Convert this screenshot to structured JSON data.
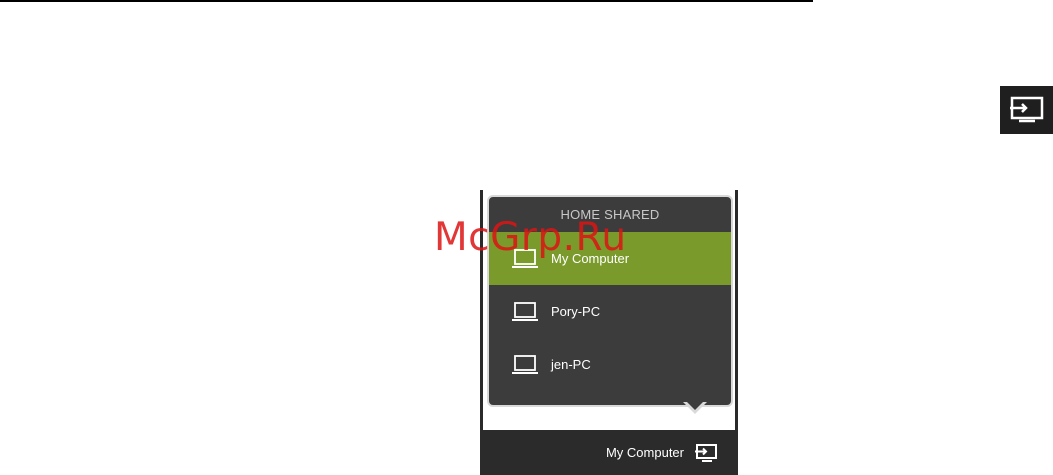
{
  "watermark": "McGrp.Ru",
  "side_icon": "input-source-icon",
  "popup": {
    "header": "HOME SHARED",
    "items": [
      {
        "label": "My Computer",
        "icon": "laptop-icon",
        "selected": true
      },
      {
        "label": "Pory-PC",
        "icon": "laptop-icon",
        "selected": false
      },
      {
        "label": "jen-PC",
        "icon": "laptop-icon",
        "selected": false
      }
    ]
  },
  "footer": {
    "current_source": "My Computer",
    "icon": "input-source-icon"
  },
  "colors": {
    "selected_item": "#7a9b2c",
    "popup_background": "#3c3c3c",
    "footer_background": "#2b2b2b",
    "watermark": "#dc1414"
  }
}
